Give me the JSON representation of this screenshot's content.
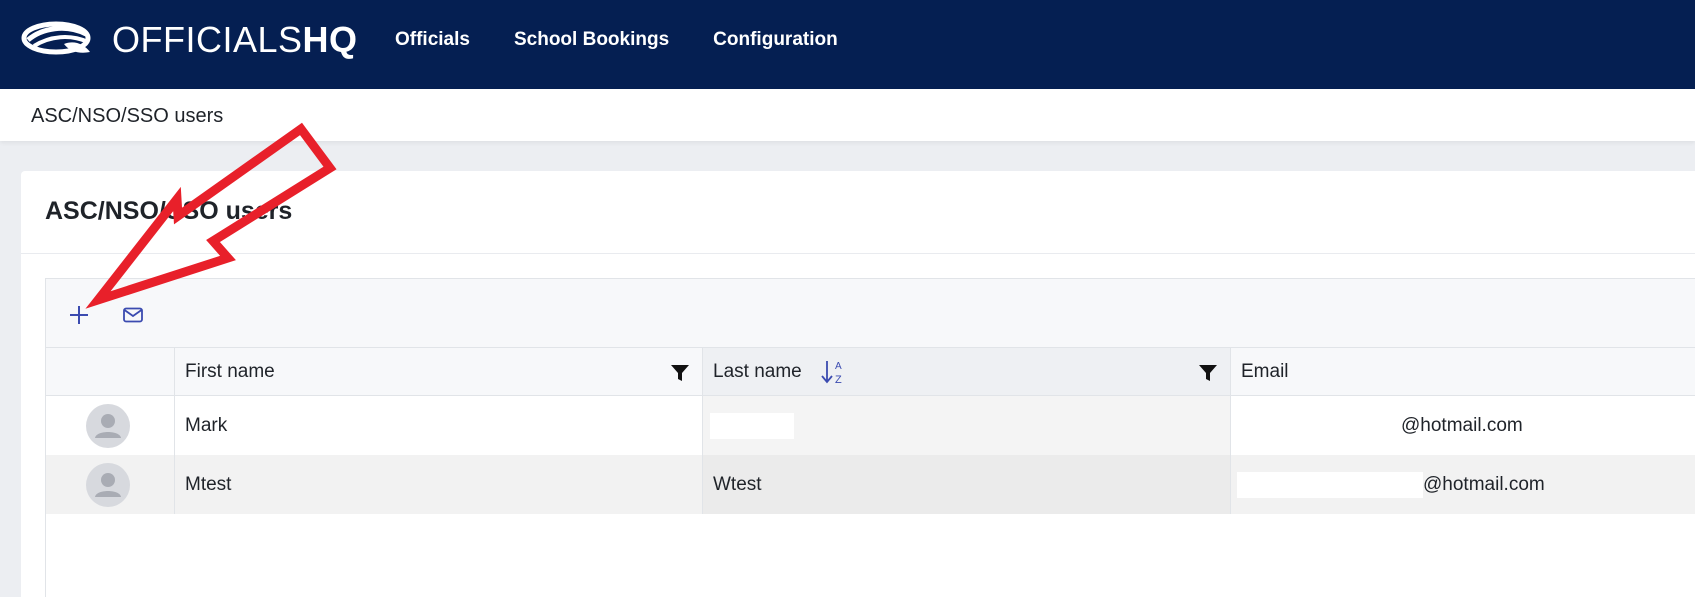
{
  "app": {
    "logo_text_light": "OFFICIALS",
    "logo_text_bold": "HQ",
    "brand_color": "#051f52"
  },
  "nav": {
    "items": [
      {
        "label": "Officials"
      },
      {
        "label": "School Bookings"
      },
      {
        "label": "Configuration"
      }
    ]
  },
  "breadcrumb": {
    "label": "ASC/NSO/SSO users"
  },
  "page": {
    "title": "ASC/NSO/SSO users"
  },
  "toolbar": {
    "add_icon": "plus-icon",
    "email_icon": "mail-icon"
  },
  "table": {
    "columns": [
      {
        "label": "First name",
        "filter": true
      },
      {
        "label": "Last name",
        "filter": true,
        "sort": "ascending"
      },
      {
        "label": "Email"
      }
    ],
    "rows": [
      {
        "first_name": "Mark",
        "last_name": "",
        "email": "@hotmail.com"
      },
      {
        "first_name": "Mtest",
        "last_name": "Wtest",
        "email": "@hotmail.com"
      }
    ]
  },
  "annotation": {
    "color": "#e8202a"
  }
}
